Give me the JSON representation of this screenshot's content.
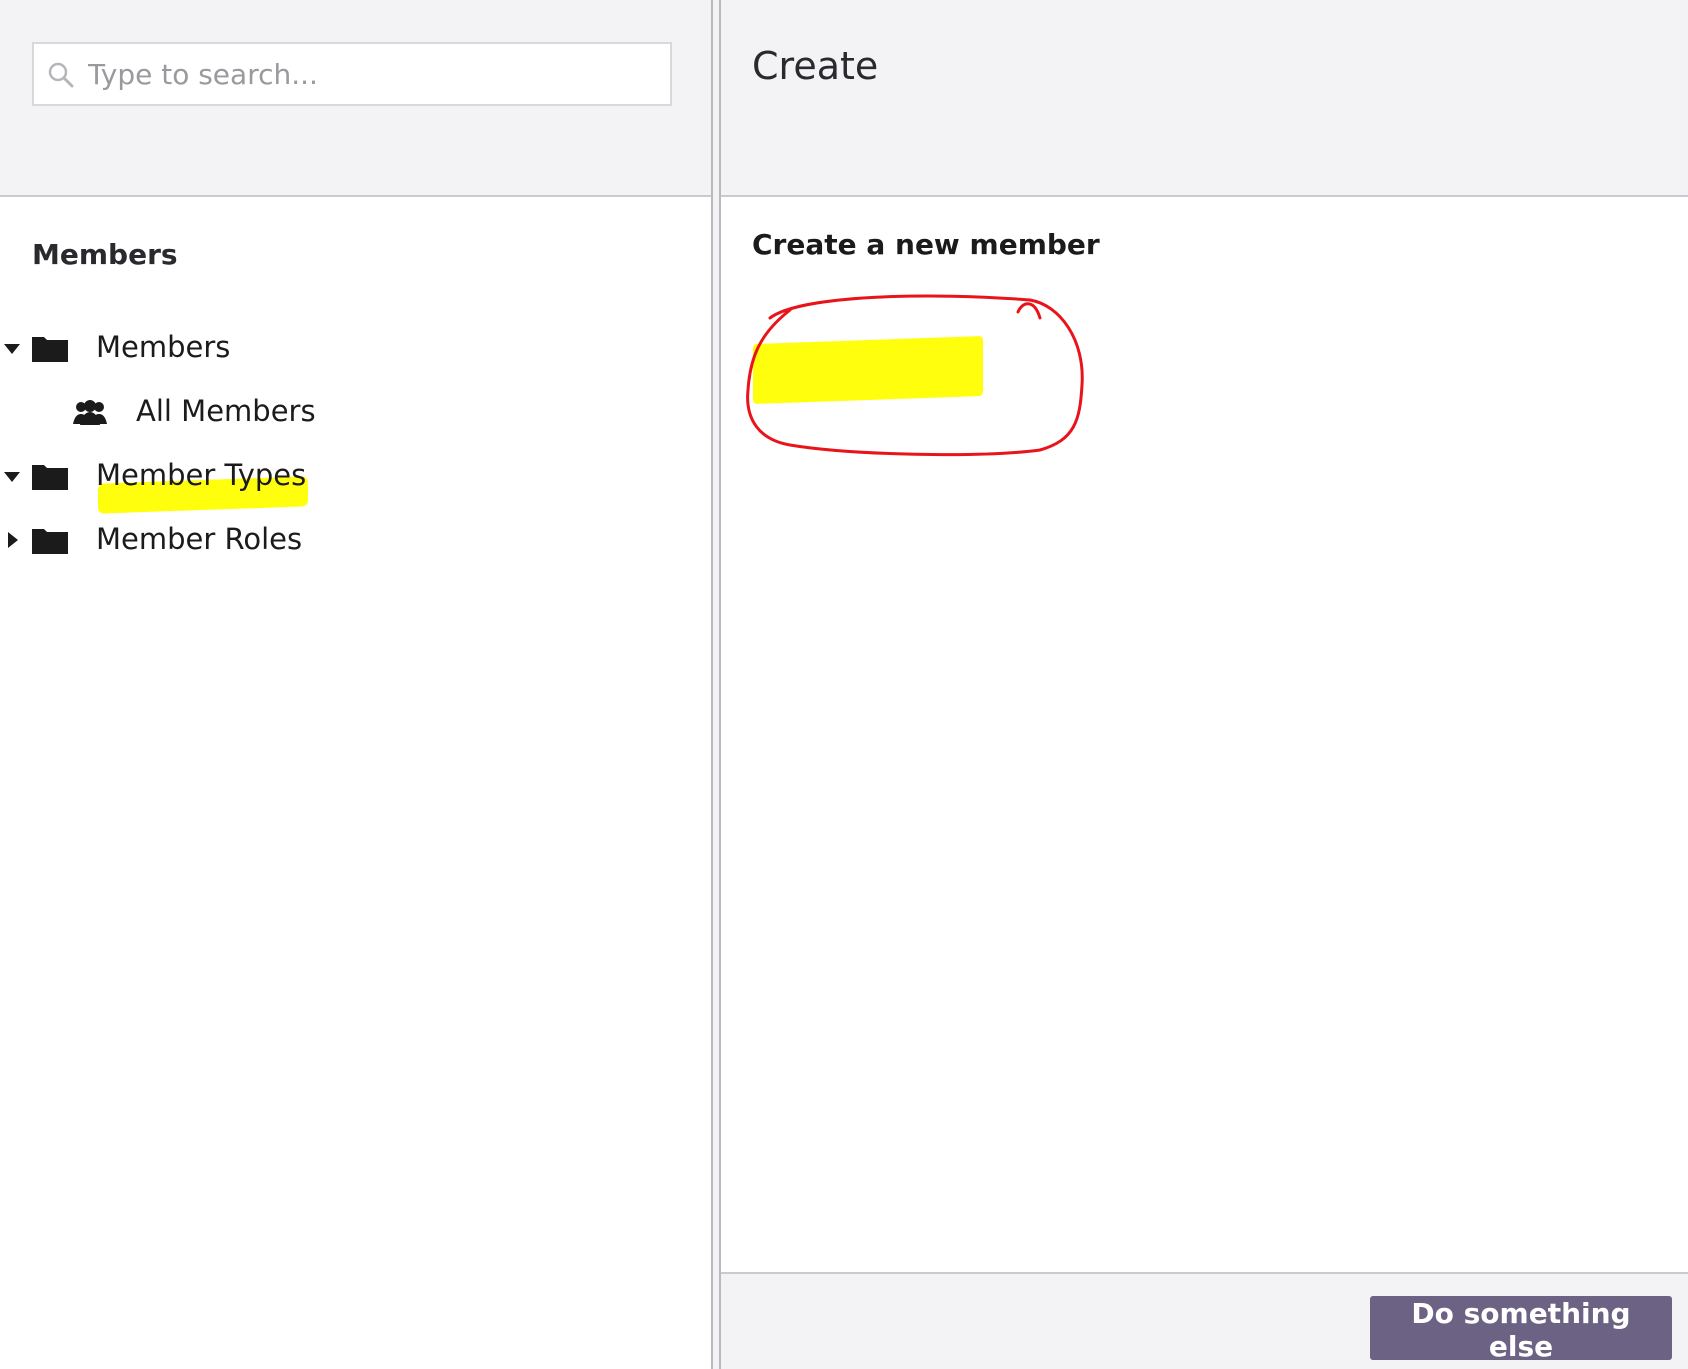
{
  "search": {
    "placeholder": "Type to search...",
    "value": ""
  },
  "sidebar": {
    "section_title": "Members",
    "tree": [
      {
        "label": "Members",
        "icon": "folder-icon",
        "expanded": true
      },
      {
        "label": "All Members",
        "icon": "members-group-icon",
        "child": true
      },
      {
        "label": "Member Types",
        "icon": "folder-icon",
        "expanded": true
      },
      {
        "label": "Member Roles",
        "icon": "folder-icon",
        "expanded": false
      }
    ]
  },
  "main": {
    "title": "Create",
    "subtitle": "Create a new member"
  },
  "footer": {
    "button_label": "Do something else"
  },
  "colors": {
    "button_bg": "#6c6384",
    "header_bg": "#f3f3f5",
    "highlight": "#ffff00",
    "annotation_red": "#e8141a"
  }
}
